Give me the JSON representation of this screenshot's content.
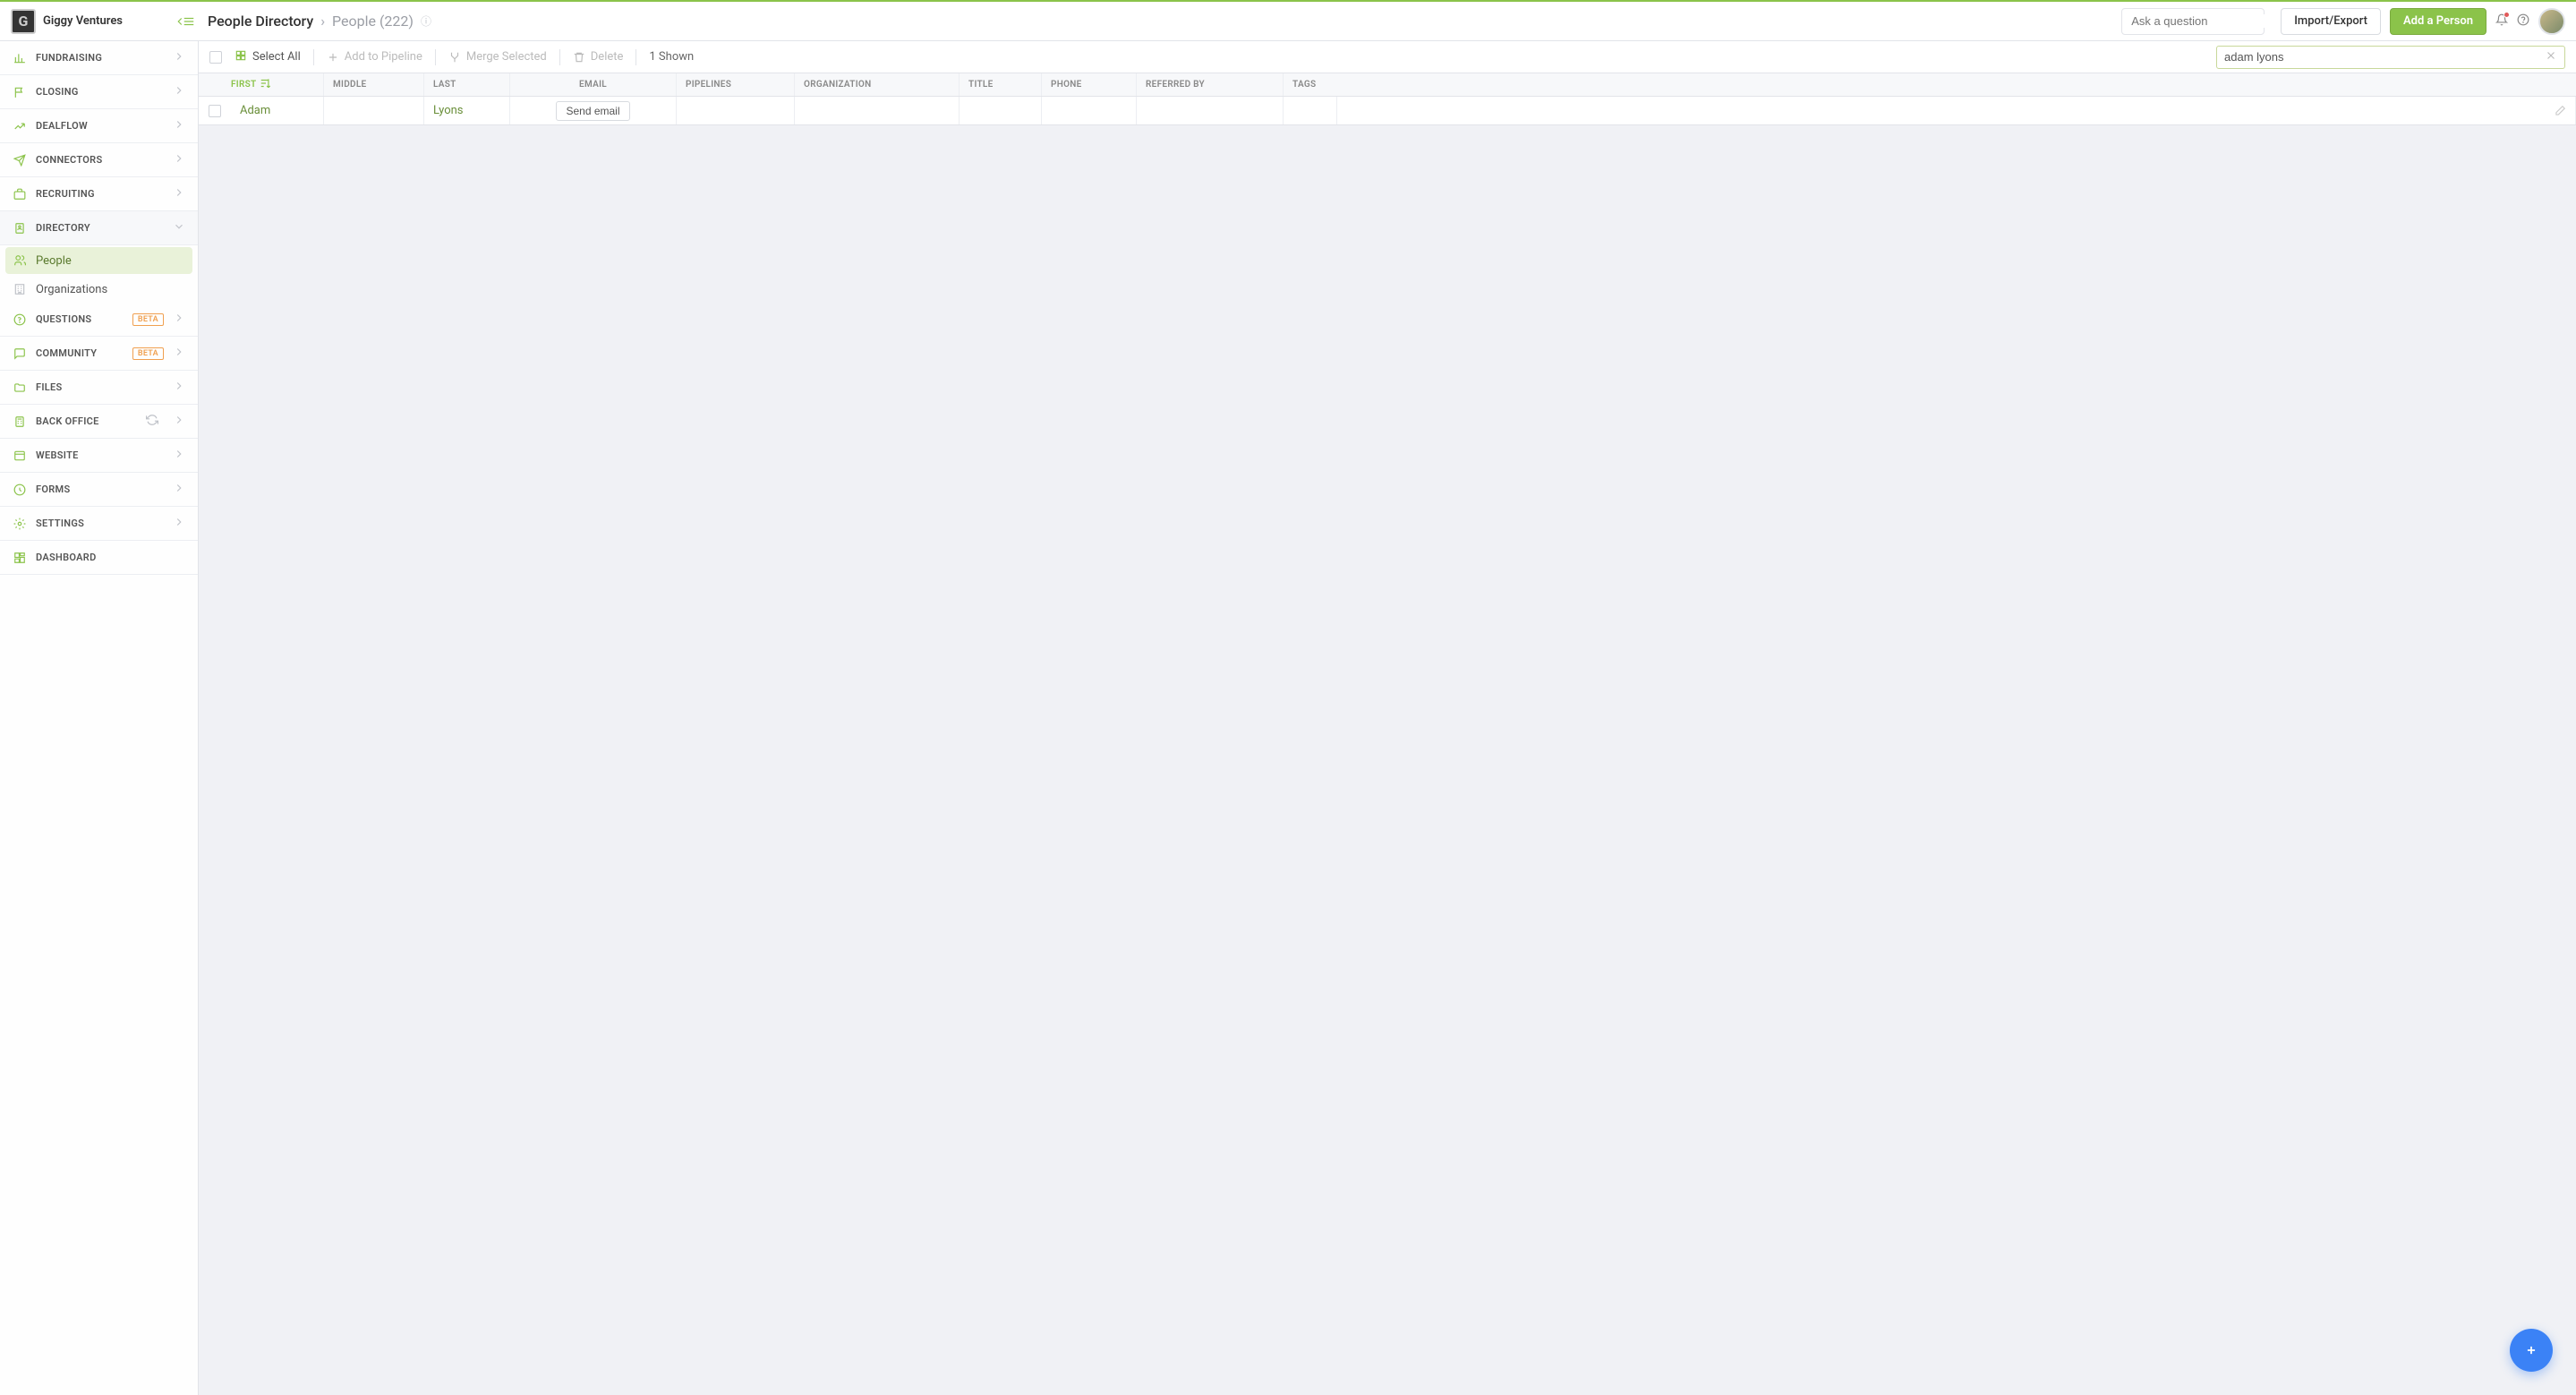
{
  "brand": {
    "name": "Giggy Ventures",
    "logo_letter": "G"
  },
  "header": {
    "breadcrumb_root": "People Directory",
    "breadcrumb_sub": "People (222)",
    "search_placeholder": "Ask a question",
    "import_export": "Import/Export",
    "add_person": "Add a Person"
  },
  "sidebar": [
    {
      "label": "FUNDRAISING",
      "icon": "bar-chart-icon",
      "chevron": true,
      "green": true
    },
    {
      "label": "CLOSING",
      "icon": "flag-icon",
      "chevron": true,
      "green": true
    },
    {
      "label": "DEALFLOW",
      "icon": "trend-icon",
      "chevron": true,
      "green": true
    },
    {
      "label": "CONNECTORS",
      "icon": "plane-icon",
      "chevron": true,
      "green": true
    },
    {
      "label": "RECRUITING",
      "icon": "briefcase-icon",
      "chevron": true,
      "green": true
    },
    {
      "label": "DIRECTORY",
      "icon": "book-icon",
      "chevron": true,
      "expanded": true,
      "green": true,
      "children": [
        {
          "label": "People",
          "icon": "people-icon",
          "active": true
        },
        {
          "label": "Organizations",
          "icon": "building-icon"
        }
      ]
    },
    {
      "label": "QUESTIONS",
      "icon": "question-icon",
      "chevron": true,
      "badge": "BETA",
      "green": true
    },
    {
      "label": "COMMUNITY",
      "icon": "chat-icon",
      "chevron": true,
      "badge": "BETA",
      "green": true
    },
    {
      "label": "FILES",
      "icon": "folder-icon",
      "chevron": true,
      "green": true
    },
    {
      "label": "BACK OFFICE",
      "icon": "calc-icon",
      "chevron": true,
      "refresh": true,
      "green": true
    },
    {
      "label": "WEBSITE",
      "icon": "window-icon",
      "chevron": true,
      "green": true
    },
    {
      "label": "FORMS",
      "icon": "form-icon",
      "chevron": true,
      "green": true
    },
    {
      "label": "SETTINGS",
      "icon": "gear-icon",
      "chevron": true,
      "green": true
    },
    {
      "label": "DASHBOARD",
      "icon": "dashboard-icon",
      "green": true
    }
  ],
  "toolbar": {
    "select_all": "Select All",
    "add_pipeline": "Add to Pipeline",
    "merge": "Merge Selected",
    "delete": "Delete",
    "shown": "1 Shown",
    "search_value": "adam lyons"
  },
  "columns": {
    "first": "FIRST",
    "middle": "MIDDLE",
    "last": "LAST",
    "email": "EMAIL",
    "pipelines": "PIPELINES",
    "org": "ORGANIZATION",
    "title": "TITLE",
    "phone": "PHONE",
    "ref": "REFERRED BY",
    "tags": "TAGS"
  },
  "rows": [
    {
      "first": "Adam",
      "last": "Lyons",
      "email_button": "Send email"
    }
  ]
}
